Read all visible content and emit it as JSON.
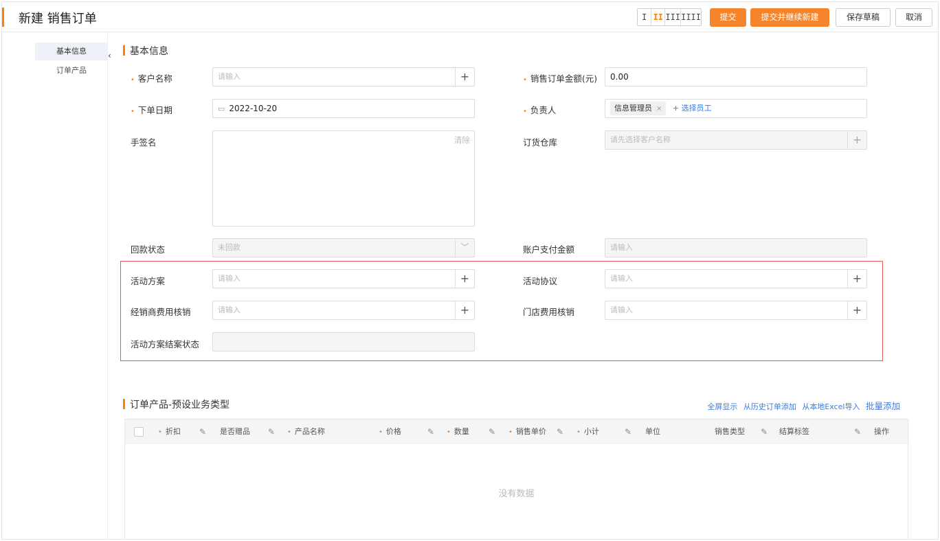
{
  "header": {
    "title": "新建 销售订单",
    "column_switch": [
      "I",
      "II",
      "III",
      "IIII"
    ],
    "buttons": {
      "submit": "提交",
      "submit_new": "提交并继续新建",
      "draft": "保存草稿",
      "cancel": "取消"
    },
    "accent_color": "#ff8000"
  },
  "sidebar": {
    "items": [
      {
        "label": "基本信息",
        "active": true
      },
      {
        "label": "订单产品",
        "active": false
      }
    ]
  },
  "basic": {
    "section_title": "基本信息",
    "customer": {
      "label": "客户名称",
      "required": true,
      "placeholder": "请输入"
    },
    "amount": {
      "label": "销售订单金额(元)",
      "required": true,
      "value": "0.00"
    },
    "order_date": {
      "label": "下单日期",
      "required": true,
      "value": "2022-10-20"
    },
    "owner": {
      "label": "负责人",
      "required": true,
      "tag": "信息管理员",
      "tag_remove": "×",
      "link": "+ 选择员工"
    },
    "signature": {
      "label": "手签名",
      "clear": "清除"
    },
    "warehouse": {
      "label": "订货仓库",
      "placeholder": "请先选择客户名称"
    },
    "payment_status": {
      "label": "回款状态",
      "value": "未回款"
    },
    "payment_amount": {
      "label": "账户支付金额",
      "placeholder": "请输入"
    },
    "activity_plan": {
      "label": "活动方案",
      "placeholder": "请输入"
    },
    "activity_agreement": {
      "label": "活动协议",
      "placeholder": "请输入"
    },
    "dealer_fee": {
      "label": "经销商费用核销",
      "placeholder": "请输入"
    },
    "store_fee": {
      "label": "门店费用核销",
      "placeholder": "请输入"
    },
    "activity_close": {
      "label": "活动方案结案状态"
    }
  },
  "products": {
    "section_title": "订单产品-预设业务类型",
    "actions": [
      "全屏显示",
      "从历史订单添加",
      "从本地Excel导入",
      "批量添加"
    ],
    "columns": [
      {
        "label": "折扣",
        "required": true
      },
      {
        "label": "是否赠品",
        "required": false
      },
      {
        "label": "产品名称",
        "required": true
      },
      {
        "label": "价格",
        "required": true
      },
      {
        "label": "数量",
        "required": true
      },
      {
        "label": "销售单价",
        "required": true
      },
      {
        "label": "小计",
        "required": true
      },
      {
        "label": "单位",
        "required": false
      },
      {
        "label": "销售类型",
        "required": false
      },
      {
        "label": "结算标签",
        "required": false
      },
      {
        "label": "操作",
        "required": false
      }
    ],
    "empty_text": "没有数据"
  },
  "icons": {
    "required_mark": "•",
    "plus": "+",
    "edit": "pencil-icon",
    "calendar": "calendar-icon",
    "chevron": "chevron-down-icon"
  }
}
